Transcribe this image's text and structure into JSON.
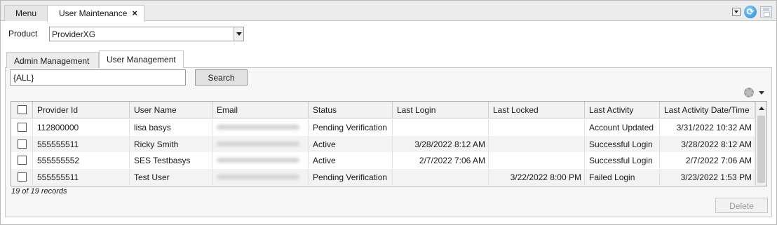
{
  "tabs": {
    "menu_label": "Menu",
    "active_label": "User Maintenance",
    "close_glyph": "×"
  },
  "product": {
    "label": "Product",
    "value": "ProviderXG"
  },
  "inner_tabs": {
    "admin": "Admin Management",
    "user": "User Management"
  },
  "search": {
    "value": "{ALL}",
    "button_label": "Search"
  },
  "grid": {
    "headers": [
      "Provider Id",
      "User Name",
      "Email",
      "Status",
      "Last Login",
      "Last Locked",
      "Last Activity",
      "Last Activity Date/Time"
    ],
    "rows": [
      {
        "provider_id": "112800000",
        "user_name": "lisa basys",
        "status": "Pending Verification",
        "last_login": "",
        "last_locked": "",
        "last_activity": "Account Updated",
        "last_activity_dt": "3/31/2022 10:32 AM"
      },
      {
        "provider_id": "555555511",
        "user_name": "Ricky Smith",
        "status": "Active",
        "last_login": "3/28/2022 8:12 AM",
        "last_locked": "",
        "last_activity": "Successful Login",
        "last_activity_dt": "3/28/2022 8:12 AM"
      },
      {
        "provider_id": "555555552",
        "user_name": "SES Testbasys",
        "status": "Active",
        "last_login": "2/7/2022 7:06 AM",
        "last_locked": "",
        "last_activity": "Successful Login",
        "last_activity_dt": "2/7/2022 7:06 AM"
      },
      {
        "provider_id": "555555511",
        "user_name": "Test User",
        "status": "Pending Verification",
        "last_login": "",
        "last_locked": "3/22/2022 8:00 PM",
        "last_activity": "Failed Login",
        "last_activity_dt": "3/23/2022 1:53 PM"
      }
    ]
  },
  "footer": {
    "record_count": "19 of 19 records",
    "delete_label": "Delete"
  },
  "icons": {
    "refresh": "refresh-icon",
    "save": "save-icon",
    "settings": "gear-icon"
  },
  "colors": {
    "tab_strip_bg": "#ececec",
    "panel_bg": "#f7f7f7",
    "grid_header_bg": "#f2f2f2",
    "refresh_blue": "#1e86d6"
  }
}
